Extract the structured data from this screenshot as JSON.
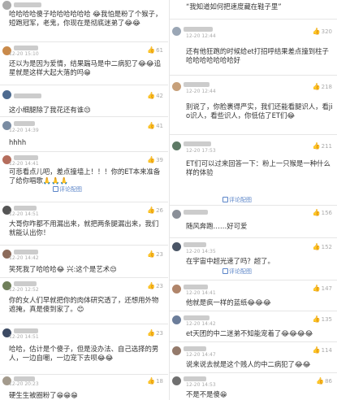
{
  "left": [
    {
      "time": "",
      "likes": "",
      "text": "哈哈哈哈傻子哈哈哈哈哈哈 😂我怕是粉了个猴子，短跑冠军，老鬼，你现在是彻底迷弟了😂😂",
      "reply": ""
    },
    {
      "time": "12-20 15:10",
      "likes": "61",
      "text": "还以为是因为爱情，结果踹马是中二病犯了😂😂追星就是这样大起大落的吗😁",
      "reply": ""
    },
    {
      "time": "",
      "likes": "42",
      "text": "这小细腿除了我花还有谁😒",
      "reply": ""
    },
    {
      "time": "12-20 14:39",
      "likes": "41",
      "text": "hhhh",
      "reply": ""
    },
    {
      "time": "12-20 14:41",
      "likes": "39",
      "text": "可悲看点儿吧，差点撞墙上！！！你的ET本来准备了给你唱歌🙏🙏🙏",
      "reply": "评论配图"
    },
    {
      "time": "12-20 14:51",
      "likes": "26",
      "text": "大哥你咋都不用漏出来，就把两条腿漏出来，我们就能认出你！",
      "reply": ""
    },
    {
      "time": "12-20 14:42",
      "likes": "23",
      "text": "笑死我了哈哈哈😂 兴:这个是艺术😒",
      "reply": ""
    },
    {
      "time": "12-20 12:52",
      "likes": "23",
      "text": "你的女人们早就把你的肉体研究透了，还想用外物遮掩，真是傻到家了。😊",
      "reply": ""
    },
    {
      "time": "12-20 14:51",
      "likes": "23",
      "text": "哈哈，估计是个傻子，但是没办法、自己选择的男人，一边自嘲，一边宠下去呗😂😂",
      "reply": ""
    },
    {
      "time": "12-20 20:23",
      "likes": "18",
      "text": "硬生生被圈粉了😁😁😁",
      "reply": ""
    }
  ],
  "right": [
    {
      "time": "",
      "likes": "",
      "text": "“我知道如何把速度藏在鞋子里”",
      "reply": ""
    },
    {
      "time": "12-20 12:44",
      "likes": "320",
      "text": "还有他狂跑的时候给et打招呼结果差点撞到柱子哈哈哈哈哈哈哈好",
      "reply": ""
    },
    {
      "time": "12-20 12:44",
      "likes": "218",
      "text": "别说了，你脸裹得严实，我们还能看腿识人，看jio识人，看些识人，你低估了ET们😂",
      "reply": ""
    },
    {
      "time": "12-20 17:53",
      "likes": "211",
      "text": "ET们可以过来回答一下：粉上一只猴是一种什么样的体验",
      "reply": "评论配图"
    },
    {
      "time": "",
      "likes": "156",
      "text": "随风奔跑……好可爱",
      "reply": ""
    },
    {
      "time": "12-20 14:35",
      "likes": "152",
      "text": "在宇宙中超光速了吗？超了。",
      "reply": "评论配图"
    },
    {
      "time": "12-20 14:41",
      "likes": "147",
      "text": "他就是疯一样的蓝纸😂😂😂",
      "reply": ""
    },
    {
      "time": "12-20 14:42",
      "likes": "135",
      "text": "et天团的中二迷弟不知能宠着了😂😂😂😂",
      "reply": ""
    },
    {
      "time": "12-20 14:47",
      "likes": "114",
      "text": "说来说去就是这个贱人的中二病犯了😂😂",
      "reply": ""
    },
    {
      "time": "12-20 14:53",
      "likes": "86",
      "text": "不是不是傻😁",
      "reply": ""
    }
  ]
}
